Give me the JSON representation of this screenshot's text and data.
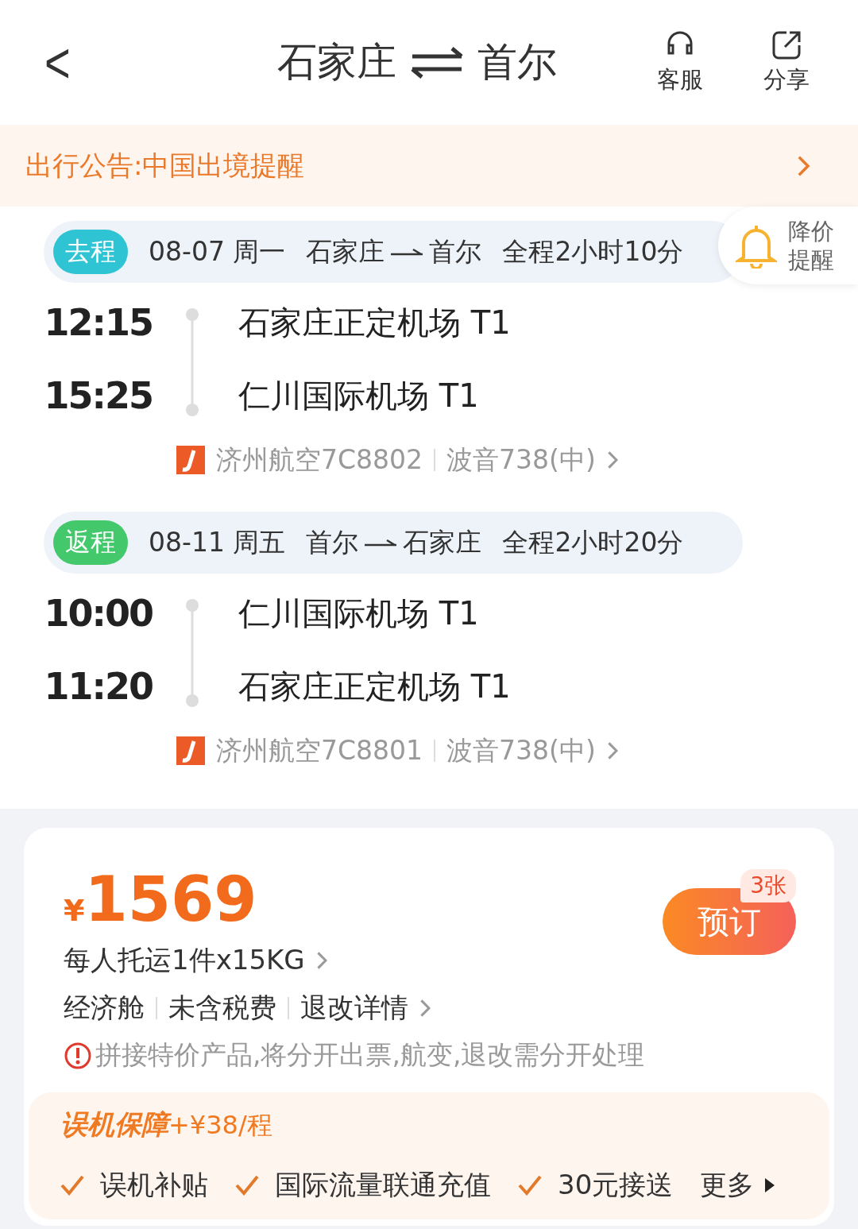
{
  "header": {
    "back": "<",
    "from": "石家庄",
    "to": "首尔",
    "actions": [
      {
        "kind": "service",
        "label": "客服"
      },
      {
        "kind": "share",
        "label": "分享"
      }
    ]
  },
  "notice": {
    "text": "出行公告:中国出境提醒"
  },
  "price_alert": {
    "line1": "降价",
    "line2": "提醒"
  },
  "segments": [
    {
      "tag": "去程",
      "color": "#2ec4d4",
      "date": "08-07 周一",
      "from": "石家庄",
      "to": "首尔",
      "duration": "全程2小时10分",
      "depart_time": "12:15",
      "depart_airport": "石家庄正定机场 T1",
      "arrive_time": "15:25",
      "arrive_airport": "仁川国际机场 T1",
      "flight": "济州航空7C8802",
      "aircraft": "波音738(中)"
    },
    {
      "tag": "返程",
      "color": "#44c86c",
      "date": "08-11 周五",
      "from": "首尔",
      "to": "石家庄",
      "duration": "全程2小时20分",
      "depart_time": "10:00",
      "depart_airport": "仁川国际机场 T1",
      "arrive_time": "11:20",
      "arrive_airport": "石家庄正定机场 T1",
      "flight": "济州航空7C8801",
      "aircraft": "波音738(中)"
    }
  ],
  "offer": {
    "currency": "¥",
    "price": "1569",
    "baggage": "每人托运1件x15KG",
    "cabin": "经济舱",
    "tax": "未含税费",
    "refund": "退改详情",
    "warning": "拼接特价产品,将分开出票,航变,退改需分开处理",
    "book": "预订",
    "tickets": "3张",
    "insurance": {
      "title": "误机保障",
      "price": "+¥38/程",
      "items": [
        "误机补贴",
        "国际流量联通充值",
        "30元接送"
      ],
      "more": "更多"
    }
  }
}
